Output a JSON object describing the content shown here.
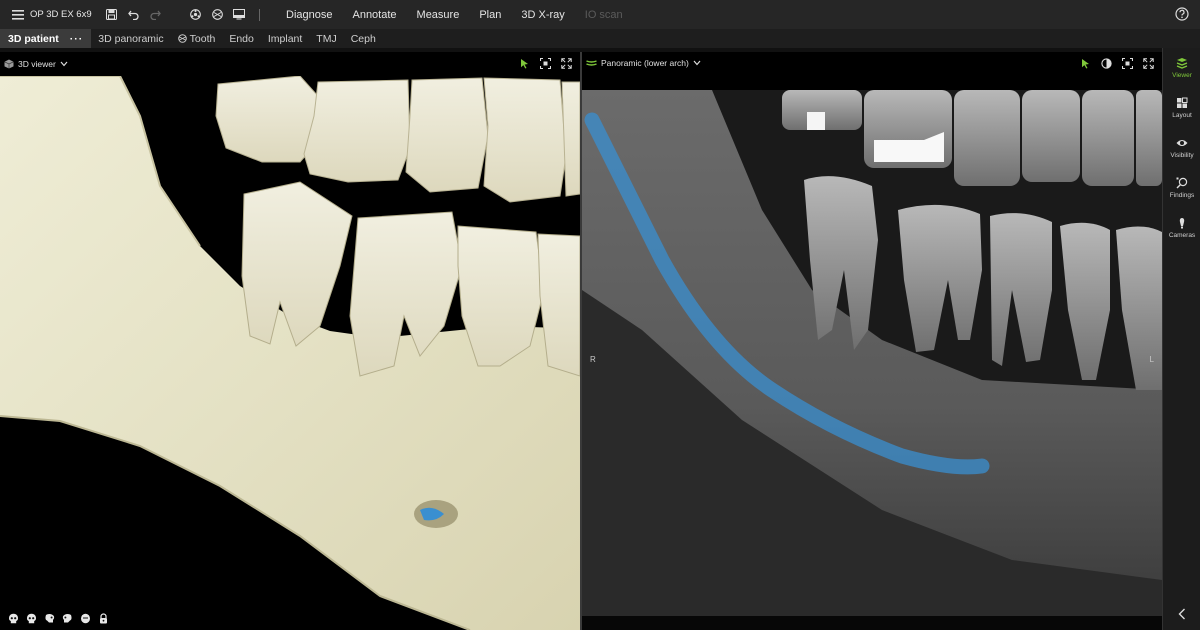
{
  "app": {
    "study_title": "OP 3D EX 6x9"
  },
  "toolbar": {
    "icons": [
      "menu-icon",
      "save-icon",
      "undo-icon",
      "redo-icon",
      "network-icon",
      "dental-chart-icon",
      "screen-icon"
    ],
    "modes": [
      {
        "label": "Diagnose",
        "enabled": true
      },
      {
        "label": "Annotate",
        "enabled": true
      },
      {
        "label": "Measure",
        "enabled": true
      },
      {
        "label": "Plan",
        "enabled": true
      },
      {
        "label": "3D X-ray",
        "enabled": true
      },
      {
        "label": "IO scan",
        "enabled": false
      }
    ]
  },
  "tabs": [
    {
      "label": "3D patient",
      "active": true
    },
    {
      "label": "3D panoramic",
      "active": false
    },
    {
      "label": "Tooth",
      "active": false,
      "icon": "tooth-icon"
    },
    {
      "label": "Endo",
      "active": false
    },
    {
      "label": "Implant",
      "active": false
    },
    {
      "label": "TMJ",
      "active": false
    },
    {
      "label": "Ceph",
      "active": false
    }
  ],
  "tab_more": "···",
  "left_view": {
    "title": "3D viewer",
    "bottom_presets": [
      "skull-front-icon",
      "skull-left-icon",
      "skull-right-icon",
      "skull-top-icon",
      "skull-bottom-icon",
      "skull-lock-icon"
    ]
  },
  "right_view": {
    "title": "Panoramic (lower arch)",
    "orient_left": "R",
    "orient_right": "L"
  },
  "sidebar": [
    {
      "label": "Viewer",
      "active": true,
      "icon": "viewer-icon"
    },
    {
      "label": "Layout",
      "active": false,
      "icon": "layout-icon"
    },
    {
      "label": "Visibility",
      "active": false,
      "icon": "eye-icon"
    },
    {
      "label": "Findings",
      "active": false,
      "icon": "findings-icon"
    },
    {
      "label": "Cameras",
      "active": false,
      "icon": "camera-icon"
    }
  ],
  "colors": {
    "accent": "#7fc83a",
    "nerve": "#3a8fd0",
    "bone": "#e6e4cc"
  }
}
